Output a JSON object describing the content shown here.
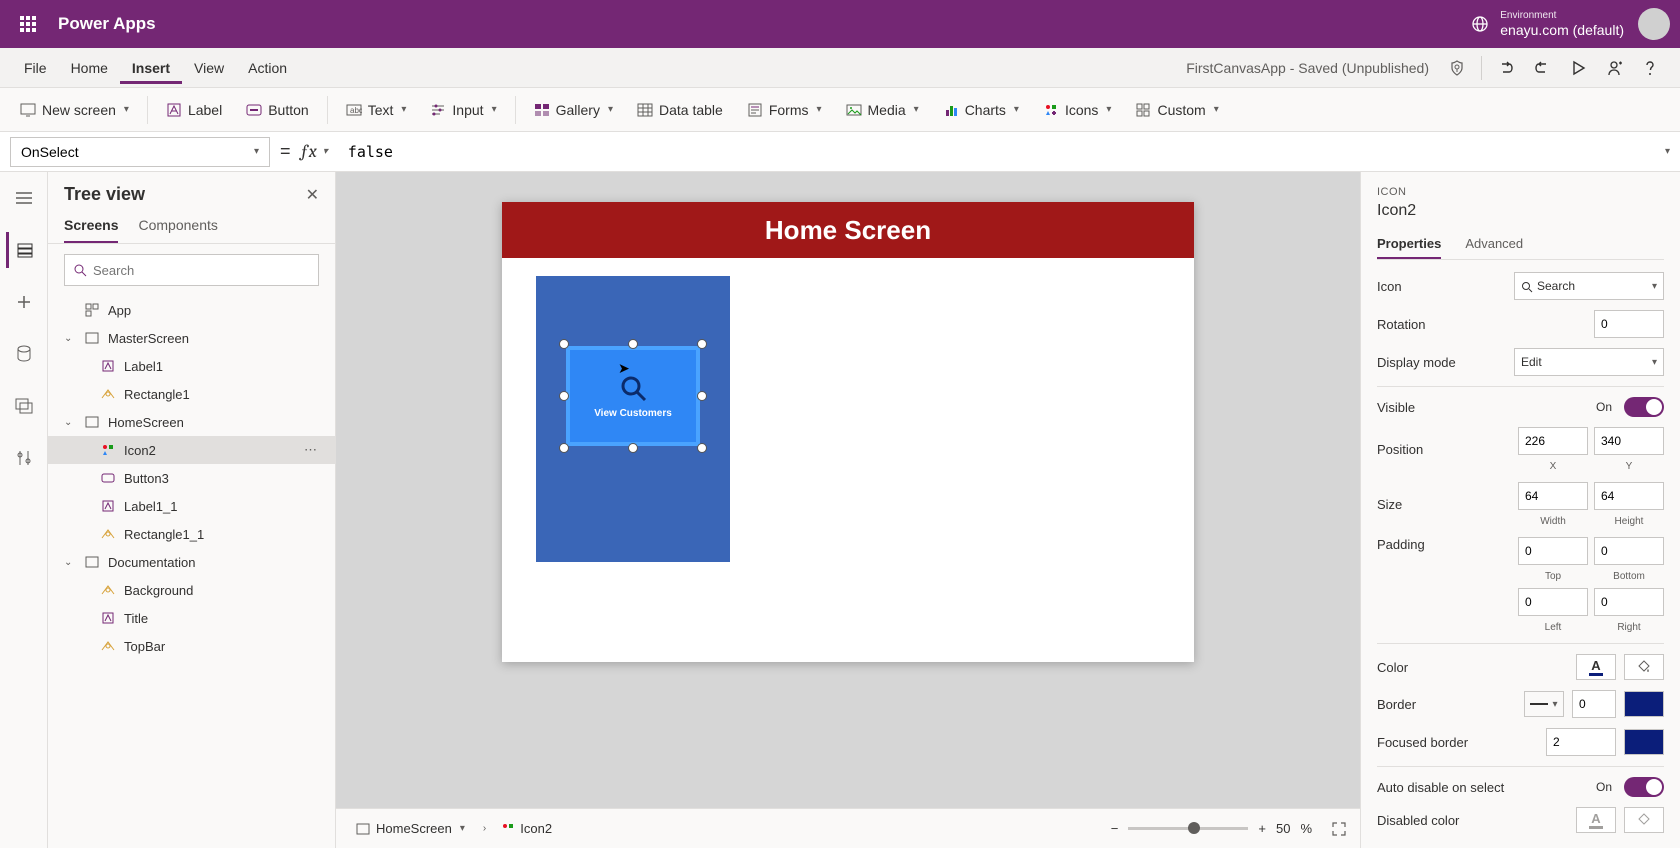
{
  "topbar": {
    "app_name": "Power Apps",
    "env_label": "Environment",
    "env_value": "enayu.com (default)"
  },
  "menu": {
    "items": [
      "File",
      "Home",
      "Insert",
      "View",
      "Action"
    ],
    "active": "Insert",
    "app_title": "FirstCanvasApp - Saved (Unpublished)"
  },
  "ribbon": {
    "new_screen": "New screen",
    "label": "Label",
    "button": "Button",
    "text": "Text",
    "input": "Input",
    "gallery": "Gallery",
    "data_table": "Data table",
    "forms": "Forms",
    "media": "Media",
    "charts": "Charts",
    "icons": "Icons",
    "custom": "Custom"
  },
  "formula": {
    "property": "OnSelect",
    "value": "false"
  },
  "tree": {
    "title": "Tree view",
    "tabs": {
      "screens": "Screens",
      "components": "Components"
    },
    "search_placeholder": "Search",
    "app": "App",
    "master": "MasterScreen",
    "master_label1": "Label1",
    "master_rect1": "Rectangle1",
    "home": "HomeScreen",
    "home_icon2": "Icon2",
    "home_button3": "Button3",
    "home_label11": "Label1_1",
    "home_rect11": "Rectangle1_1",
    "doc": "Documentation",
    "doc_bg": "Background",
    "doc_title": "Title",
    "doc_topbar": "TopBar"
  },
  "canvas": {
    "header": "Home Screen",
    "tile_label": "View Customers"
  },
  "footer": {
    "crumb1": "HomeScreen",
    "crumb2": "Icon2",
    "zoom_value": "50",
    "zoom_suffix": "%"
  },
  "props": {
    "type": "ICON",
    "name": "Icon2",
    "tabs": {
      "properties": "Properties",
      "advanced": "Advanced"
    },
    "icon_label": "Icon",
    "icon_value": "Search",
    "rotation_label": "Rotation",
    "rotation_value": "0",
    "display_label": "Display mode",
    "display_value": "Edit",
    "visible_label": "Visible",
    "visible_value": "On",
    "position_label": "Position",
    "x": "226",
    "y": "340",
    "x_label": "X",
    "y_label": "Y",
    "size_label": "Size",
    "w": "64",
    "h": "64",
    "w_label": "Width",
    "h_label": "Height",
    "padding_label": "Padding",
    "pt": "0",
    "pb": "0",
    "pl": "0",
    "pr": "0",
    "pt_label": "Top",
    "pb_label": "Bottom",
    "pl_label": "Left",
    "pr_label": "Right",
    "color_label": "Color",
    "border_label": "Border",
    "border_value": "0",
    "focused_label": "Focused border",
    "focused_value": "2",
    "auto_disable_label": "Auto disable on select",
    "auto_disable_value": "On",
    "disabled_color_label": "Disabled color"
  }
}
